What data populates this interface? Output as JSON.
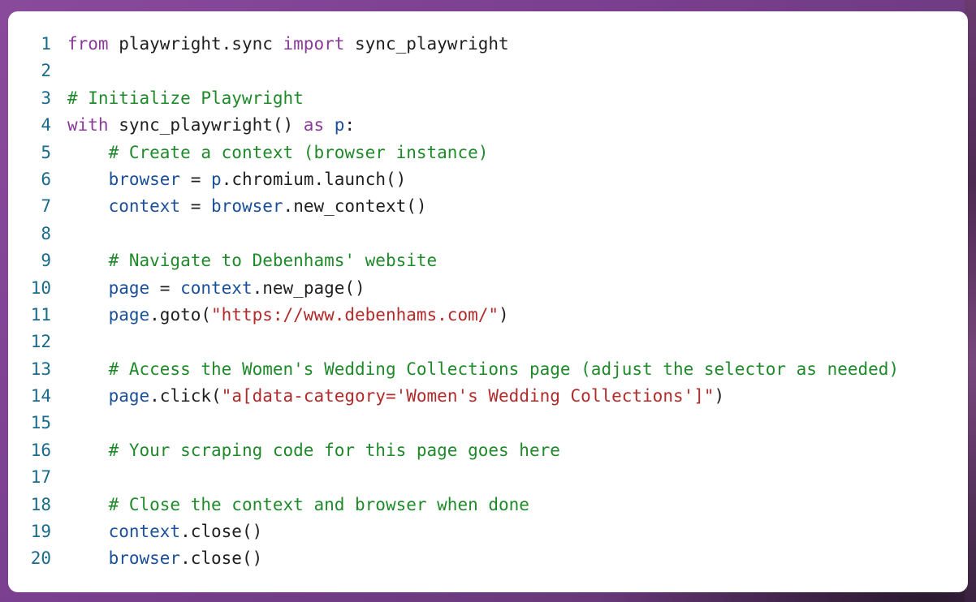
{
  "code": {
    "lines": [
      {
        "n": "1",
        "tokens": [
          {
            "t": "kw",
            "v": "from"
          },
          {
            "t": "pl",
            "v": " playwright.sync "
          },
          {
            "t": "kw",
            "v": "import"
          },
          {
            "t": "pl",
            "v": " sync_playwright"
          }
        ]
      },
      {
        "n": "2",
        "tokens": []
      },
      {
        "n": "3",
        "tokens": [
          {
            "t": "cm",
            "v": "# Initialize Playwright"
          }
        ]
      },
      {
        "n": "4",
        "tokens": [
          {
            "t": "kw",
            "v": "with"
          },
          {
            "t": "pl",
            "v": " sync_playwright() "
          },
          {
            "t": "kw",
            "v": "as"
          },
          {
            "t": "pl",
            "v": " "
          },
          {
            "t": "var",
            "v": "p"
          },
          {
            "t": "pl",
            "v": ":"
          }
        ]
      },
      {
        "n": "5",
        "tokens": [
          {
            "t": "pl",
            "v": "    "
          },
          {
            "t": "cm",
            "v": "# Create a context (browser instance)"
          }
        ]
      },
      {
        "n": "6",
        "tokens": [
          {
            "t": "pl",
            "v": "    "
          },
          {
            "t": "var",
            "v": "browser"
          },
          {
            "t": "pl",
            "v": " = "
          },
          {
            "t": "var",
            "v": "p"
          },
          {
            "t": "pl",
            "v": ".chromium.launch()"
          }
        ]
      },
      {
        "n": "7",
        "tokens": [
          {
            "t": "pl",
            "v": "    "
          },
          {
            "t": "var",
            "v": "context"
          },
          {
            "t": "pl",
            "v": " = "
          },
          {
            "t": "var",
            "v": "browser"
          },
          {
            "t": "pl",
            "v": ".new_context()"
          }
        ]
      },
      {
        "n": "8",
        "tokens": []
      },
      {
        "n": "9",
        "tokens": [
          {
            "t": "pl",
            "v": "    "
          },
          {
            "t": "cm",
            "v": "# Navigate to Debenhams' website"
          }
        ]
      },
      {
        "n": "10",
        "tokens": [
          {
            "t": "pl",
            "v": "    "
          },
          {
            "t": "var",
            "v": "page"
          },
          {
            "t": "pl",
            "v": " = "
          },
          {
            "t": "var",
            "v": "context"
          },
          {
            "t": "pl",
            "v": ".new_page()"
          }
        ]
      },
      {
        "n": "11",
        "tokens": [
          {
            "t": "pl",
            "v": "    "
          },
          {
            "t": "var",
            "v": "page"
          },
          {
            "t": "pl",
            "v": ".goto("
          },
          {
            "t": "str",
            "v": "\"https://www.debenhams.com/\""
          },
          {
            "t": "pl",
            "v": ")"
          }
        ]
      },
      {
        "n": "12",
        "tokens": []
      },
      {
        "n": "13",
        "tokens": [
          {
            "t": "pl",
            "v": "    "
          },
          {
            "t": "cm",
            "v": "# Access the Women's Wedding Collections page (adjust the selector as needed)"
          }
        ]
      },
      {
        "n": "14",
        "tokens": [
          {
            "t": "pl",
            "v": "    "
          },
          {
            "t": "var",
            "v": "page"
          },
          {
            "t": "pl",
            "v": ".click("
          },
          {
            "t": "str",
            "v": "\"a[data-category='Women's Wedding Collections']\""
          },
          {
            "t": "pl",
            "v": ")"
          }
        ]
      },
      {
        "n": "15",
        "tokens": []
      },
      {
        "n": "16",
        "tokens": [
          {
            "t": "pl",
            "v": "    "
          },
          {
            "t": "cm",
            "v": "# Your scraping code for this page goes here"
          }
        ]
      },
      {
        "n": "17",
        "tokens": []
      },
      {
        "n": "18",
        "tokens": [
          {
            "t": "pl",
            "v": "    "
          },
          {
            "t": "cm",
            "v": "# Close the context and browser when done"
          }
        ]
      },
      {
        "n": "19",
        "tokens": [
          {
            "t": "pl",
            "v": "    "
          },
          {
            "t": "var",
            "v": "context"
          },
          {
            "t": "pl",
            "v": ".close()"
          }
        ]
      },
      {
        "n": "20",
        "tokens": [
          {
            "t": "pl",
            "v": "    "
          },
          {
            "t": "var",
            "v": "browser"
          },
          {
            "t": "pl",
            "v": ".close()"
          }
        ]
      }
    ]
  },
  "colors": {
    "keyword": "#8a3b9a",
    "comment": "#1f8a2a",
    "string": "#b22a2a",
    "variable": "#1a4f9a",
    "line_number": "#1a6a8a",
    "panel_background": "#ffffff",
    "page_background": "#7a3f8f"
  }
}
